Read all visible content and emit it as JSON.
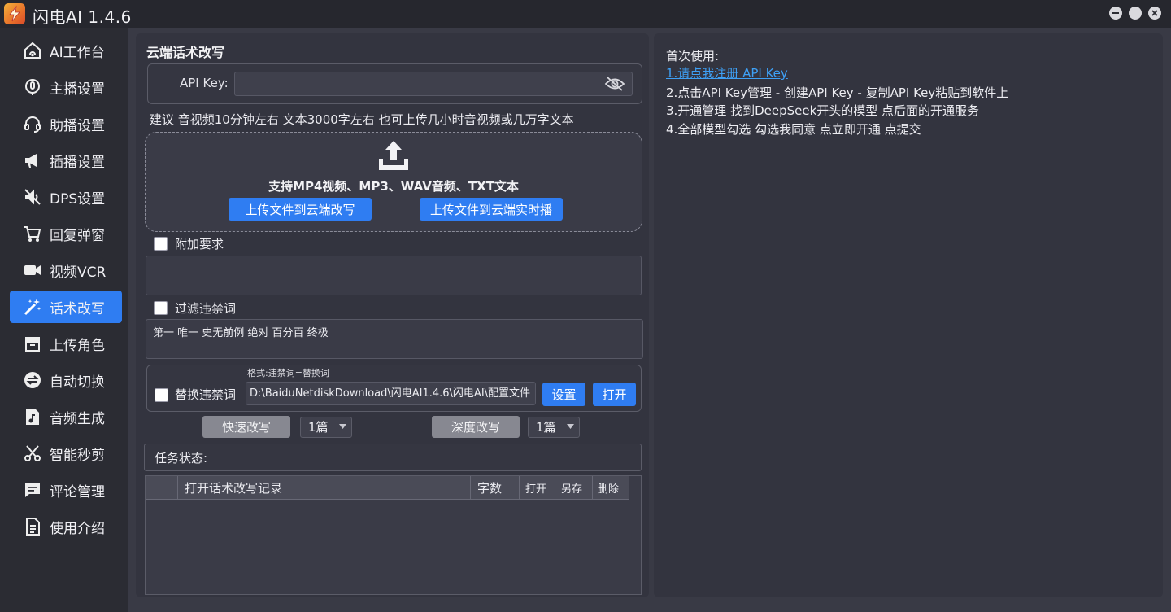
{
  "app": {
    "title": "闪电AI 1.4.6"
  },
  "sidebar": {
    "items": [
      {
        "label": "AI工作台",
        "icon": "house-signal-icon"
      },
      {
        "label": "主播设置",
        "icon": "anchor-mic-icon"
      },
      {
        "label": "助播设置",
        "icon": "headset-icon"
      },
      {
        "label": "插播设置",
        "icon": "megaphone-icon"
      },
      {
        "label": "DPS设置",
        "icon": "mute-speaker-icon"
      },
      {
        "label": "回复弹窗",
        "icon": "cart-icon"
      },
      {
        "label": "视频VCR",
        "icon": "video-camera-icon"
      },
      {
        "label": "话术改写",
        "icon": "magic-wand-icon",
        "active": true
      },
      {
        "label": "上传角色",
        "icon": "box-icon"
      },
      {
        "label": "自动切换",
        "icon": "switch-icon"
      },
      {
        "label": "音频生成",
        "icon": "music-file-icon"
      },
      {
        "label": "智能秒剪",
        "icon": "scissors-icon"
      },
      {
        "label": "评论管理",
        "icon": "comment-icon"
      },
      {
        "label": "使用介绍",
        "icon": "document-icon"
      }
    ]
  },
  "main": {
    "section_title": "云端话术改写",
    "api_key": {
      "label": "API Key:",
      "value": ""
    },
    "hint": "建议 音视频10分钟左右 文本3000字左右    也可上传几小时音视频或几万字文本",
    "upload": {
      "formats": "支持MP4视频、MP3、WAV音频、TXT文本",
      "btn_rewrite": "上传文件到云端改写",
      "btn_live": "上传文件到云端实时播"
    },
    "extra_req": {
      "label": "附加要求",
      "value": ""
    },
    "filter": {
      "label": "过滤违禁词",
      "value": "第一 唯一 史无前例 绝对 百分百 终极"
    },
    "replace": {
      "format_hint": "格式:违禁词=替换词",
      "label": "替换违禁词",
      "path": "D:\\BaiduNetdiskDownload\\闪电AI1.4.6\\闪电AI\\配置文件",
      "btn_set": "设置",
      "btn_open": "打开"
    },
    "rewrite": {
      "quick_label": "快速改写",
      "quick_count": "1篇",
      "deep_label": "深度改写",
      "deep_count": "1篇"
    },
    "status_label": "任务状态:",
    "table": {
      "columns": [
        "",
        "打开话术改写记录",
        "字数",
        "打开",
        "另存",
        "删除"
      ]
    }
  },
  "guide": {
    "heading": "首次使用:",
    "step1": "1.请点我注册 API Key",
    "step2": "2.点击API Key管理 - 创建API Key - 复制API Key粘贴到软件上",
    "step3": "3.开通管理 找到DeepSeek开头的模型 点后面的开通服务",
    "step4": "4.全部模型勾选 勾选我同意 点立即开通 点提交"
  },
  "colors": {
    "accent": "#2f7df2",
    "link": "#3ea0f5",
    "panel": "#33343f"
  }
}
